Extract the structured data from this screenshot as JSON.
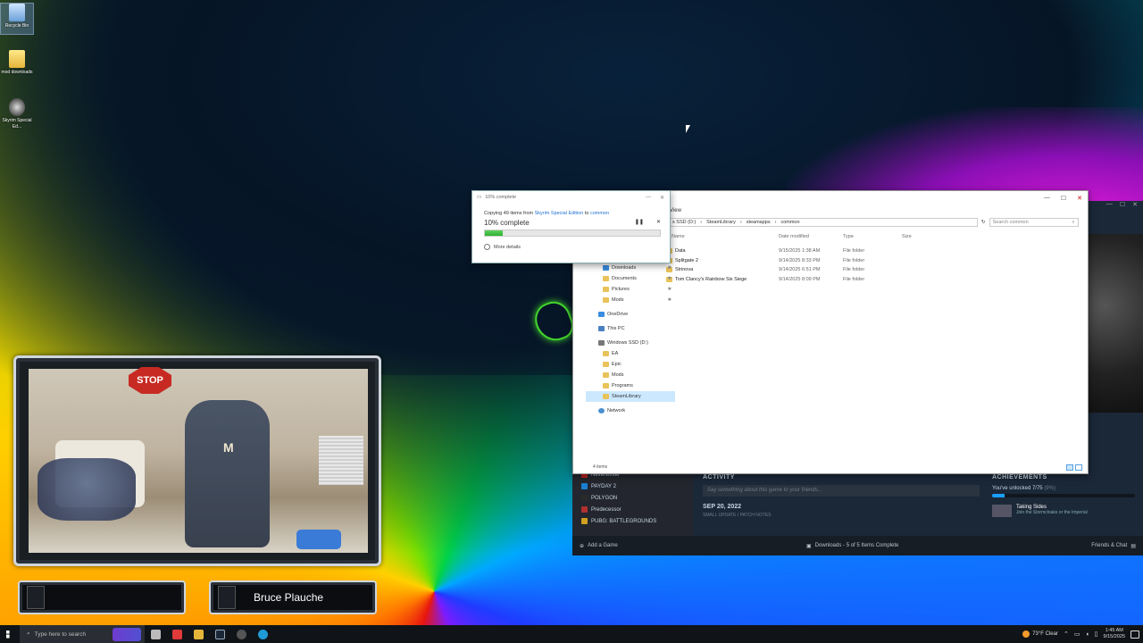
{
  "desktop": {
    "icons": [
      {
        "label": "Recycle Bin",
        "icon": "recycle-bin-icon"
      },
      {
        "label": "mod downloads",
        "icon": "folder-icon"
      },
      {
        "label": "Skyrim Special Ed...",
        "icon": "skyrim-icon"
      }
    ]
  },
  "copy_dialog": {
    "title": "10% complete",
    "line_prefix": "Copying 49 items from",
    "source": "Skyrim Special Edition",
    "line_mid": "to",
    "destination": "common",
    "percent_label": "10% complete",
    "progress_percent": 10,
    "pause_glyph": "❚❚",
    "cancel_glyph": "✕",
    "more_details": "More details"
  },
  "explorer": {
    "ribbon_view": "View",
    "breadcrumb": [
      "s SSD (D:)",
      "SteamLibrary",
      "steamapps",
      "common"
    ],
    "search_placeholder": "Search common",
    "columns": {
      "name": "Name",
      "date": "Date modified",
      "type": "Type",
      "size": "Size"
    },
    "nav": [
      {
        "label": "Downloads",
        "kind": "blue",
        "level": 2,
        "pinned": true
      },
      {
        "label": "Documents",
        "kind": "folder",
        "level": 2,
        "pinned": true
      },
      {
        "label": "Pictures",
        "kind": "folder",
        "level": 2,
        "pinned": true
      },
      {
        "label": "Mods",
        "kind": "folder",
        "level": 2,
        "pinned": true
      },
      {
        "label": "OneDrive",
        "kind": "blue",
        "level": 1,
        "pinned": false
      },
      {
        "label": "This PC",
        "kind": "pc",
        "level": 1,
        "pinned": false
      },
      {
        "label": "Windows SSD (D:)",
        "kind": "drive",
        "level": 1,
        "pinned": false
      },
      {
        "label": "EA",
        "kind": "folder",
        "level": 2,
        "pinned": false
      },
      {
        "label": "Epic",
        "kind": "folder",
        "level": 2,
        "pinned": false
      },
      {
        "label": "Mods",
        "kind": "folder",
        "level": 2,
        "pinned": false
      },
      {
        "label": "Programs",
        "kind": "folder",
        "level": 2,
        "pinned": false
      },
      {
        "label": "SteamLibrary",
        "kind": "folder",
        "level": 2,
        "pinned": false,
        "selected": true
      },
      {
        "label": "Network",
        "kind": "net",
        "level": 1,
        "pinned": false
      }
    ],
    "rows": [
      {
        "name": "Data",
        "date": "9/15/2025 1:38 AM",
        "type": "File folder"
      },
      {
        "name": "Splitgate 2",
        "date": "9/14/2025 8:33 PM",
        "type": "File folder"
      },
      {
        "name": "Strinova",
        "date": "9/14/2025 6:51 PM",
        "type": "File folder"
      },
      {
        "name": "Tom Clancy's Rainbow Six Siege",
        "date": "9/14/2025 8:09 PM",
        "type": "File folder"
      }
    ],
    "status": "4 items"
  },
  "steam": {
    "games": [
      {
        "name": "Neverwinter",
        "color": "#c02020"
      },
      {
        "name": "PAYDAY 2",
        "color": "#1a7fd0"
      },
      {
        "name": "POLYGON",
        "color": "#2a2a2a"
      },
      {
        "name": "Predecessor",
        "color": "#b03030"
      },
      {
        "name": "PUBG: BATTLEGROUNDS",
        "color": "#d0a020"
      }
    ],
    "activity_title": "ACTIVITY",
    "say_placeholder": "Say something about this game to your friends...",
    "date": "SEP 20, 2022",
    "small_update": "SMALL UPDATE / PATCH NOTES",
    "achievements_title": "ACHIEVEMENTS",
    "unlocked_text": "You've unlocked 7/75",
    "unlocked_pct": "(9%)",
    "unlocked_fraction": 0.09,
    "achievement_name": "Taking Sides",
    "achievement_desc": "Join the Stormcloaks or the Imperial",
    "add_game": "Add a Game",
    "downloads_status": "Downloads - 5 of 5 Items Complete",
    "friends": "Friends & Chat"
  },
  "stream": {
    "streamer_name": "Bruce Plauche",
    "sign_text": "STOP"
  },
  "taskbar": {
    "search_placeholder": "Type here to search",
    "weather": "73°F  Clear",
    "time": "1:45 AM",
    "date": "9/15/2025",
    "apps": [
      {
        "icon": "task-view-icon",
        "color": "#bbbbbb"
      },
      {
        "icon": "vivaldi-icon",
        "color": "#e03a3a"
      },
      {
        "icon": "file-explorer-icon",
        "color": "#e5b53a"
      },
      {
        "icon": "steam-icon",
        "color": "#1b2838"
      },
      {
        "icon": "obs-icon",
        "color": "#555555"
      },
      {
        "icon": "edge-icon",
        "color": "#1f9bd8"
      }
    ]
  }
}
